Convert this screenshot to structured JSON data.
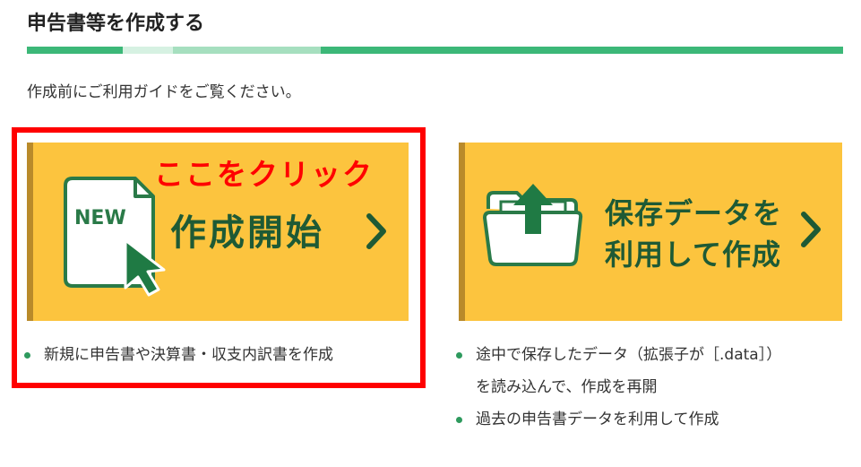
{
  "page": {
    "title": "申告書等を作成する",
    "intro": "作成前にご利用ガイドをご覧ください。"
  },
  "card_new": {
    "label": "作成開始",
    "badge": "NEW",
    "annotation": "ここをクリック",
    "icons": [
      "document-icon",
      "cursor-arrow-icon",
      "chevron-right-icon"
    ],
    "bullets": [
      "新規に申告書や決算書・収支内訳書を作成"
    ]
  },
  "card_load": {
    "label_line1": "保存データを",
    "label_line2": "利用して作成",
    "icons": [
      "folder-upload-icon",
      "chevron-right-icon"
    ],
    "bullet1_line1": "途中で保存したデータ（拡張子が［.data］）",
    "bullet1_line2": "を読み込んで、作成を再開",
    "bullet2": "過去の申告書データを利用して作成"
  },
  "colors": {
    "card_bg": "#fcc43e",
    "card_border": "#b98a2a",
    "label_green": "#1e5a35",
    "accent_green": "#3cb878",
    "annotation_red": "#ff0000"
  }
}
